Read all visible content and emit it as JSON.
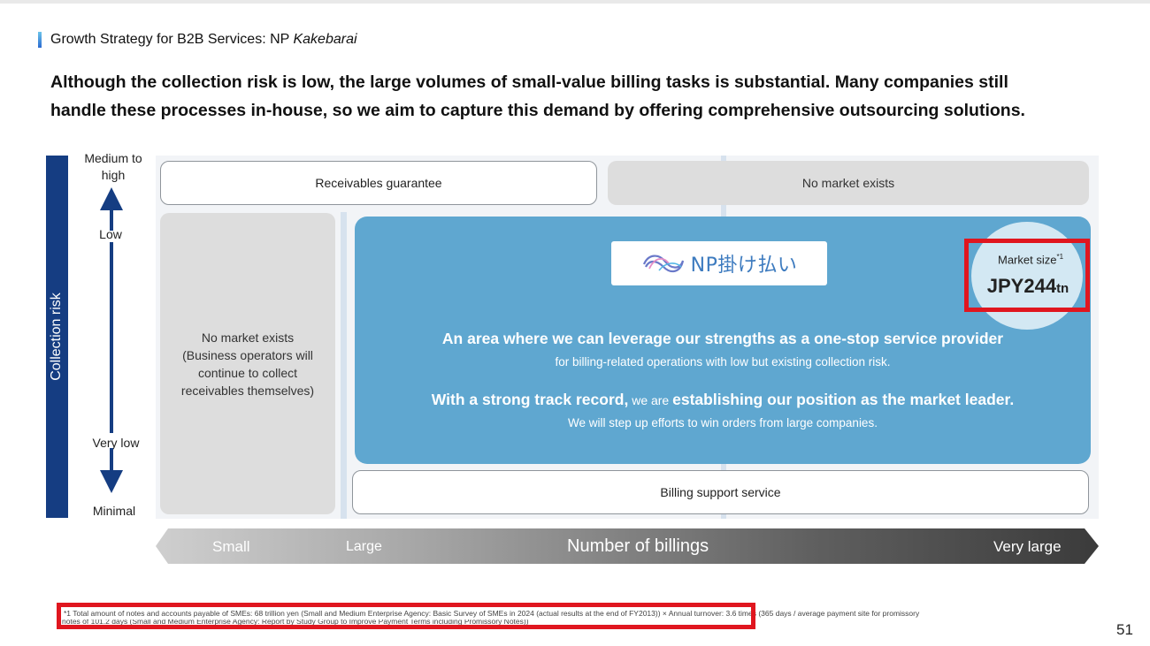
{
  "header": {
    "section_prefix": "Growth Strategy for B2B Services: NP ",
    "section_italic": "Kakebarai",
    "headline_line1": "Although the collection risk is low, the large volumes of small-value billing tasks is substantial. Many companies still",
    "headline_line2": "handle these processes in-house, so we aim to capture this demand by offering comprehensive outsourcing solutions."
  },
  "y_axis": {
    "title": "Collection risk",
    "medium_high": "Medium to high",
    "low": "Low",
    "very_low": "Very low",
    "minimal": "Minimal"
  },
  "boxes": {
    "receivables_guarantee": "Receivables guarantee",
    "no_market_top": "No market exists",
    "no_market_left_1": "No market exists",
    "no_market_left_2": "(Business operators will",
    "no_market_left_3": "continue to collect",
    "no_market_left_4": "receivables themselves)",
    "billing_support": "Billing support service"
  },
  "np_area": {
    "logo_text": "NP掛け払い",
    "line1": "An area where we can leverage our strengths as a one-stop service provider",
    "line2": "for billing-related operations with low but existing collection risk.",
    "line3_bold_a": "With a strong track record,",
    "line3_normal": " we are ",
    "line3_bold_b": "establishing our position as the market leader.",
    "line4": "We will step up efforts to win orders from large companies."
  },
  "market": {
    "label": "Market size",
    "footnote_ref": "*1",
    "value": "JPY244",
    "unit": "tn"
  },
  "x_axis": {
    "small": "Small",
    "large": "Large",
    "title": "Number of billings",
    "very_large": "Very large"
  },
  "footnote": {
    "highlighted": "*1 Total amount of notes and accounts payable of SMEs: 68 trillion yen (Small and Medium Enterprise Agency: Basic Survey of SMEs in 2024 (actual results at the end of FY2013))",
    "rest": " × Annual turnover: 3.6 times (365 days / average payment site for promissory",
    "line2": "notes of 101.2 days (Small and Medium Enterprise Agency: Report by Study Group to Improve Payment Terms including Promissory Notes))"
  },
  "page_number": "51",
  "colors": {
    "axis_band": "#153d82",
    "np_area": "#5fa7d0",
    "highlight": "#e0161f"
  }
}
